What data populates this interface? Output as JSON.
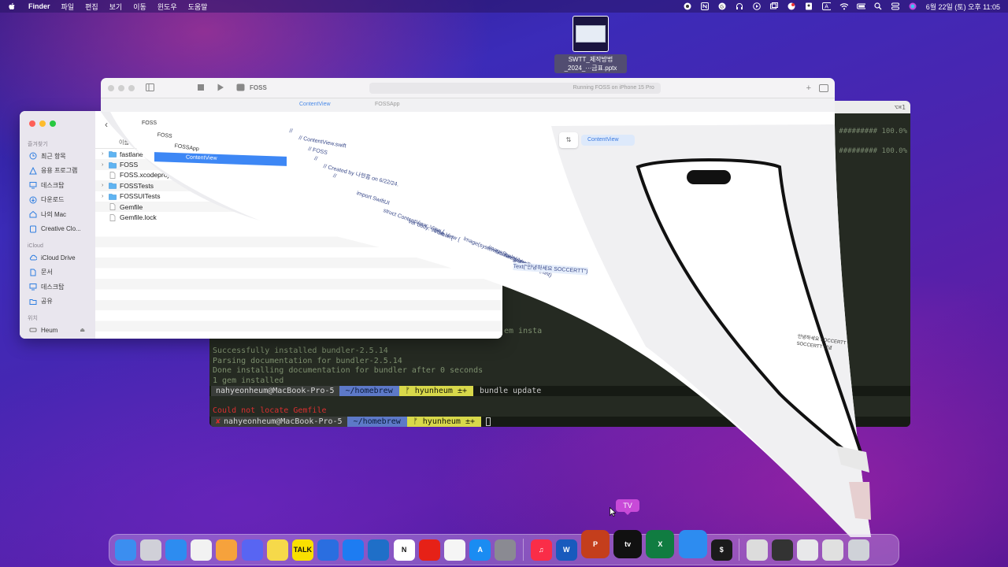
{
  "menubar": {
    "app": "Finder",
    "items": [
      "파일",
      "편집",
      "보기",
      "이동",
      "윈도우",
      "도움말"
    ],
    "clock": "6월 22일 (토) 오후 11:05",
    "status_icons": [
      "record-icon",
      "n-icon",
      "app-icon",
      "headphones-icon",
      "play-icon",
      "window-icon",
      "notify-icon",
      "person-icon",
      "a-icon",
      "wifi-icon",
      "battery-icon",
      "search-icon",
      "control-center-icon",
      "siri-icon"
    ]
  },
  "desktop_file": {
    "name_line1": "SWTT_제작방법",
    "name_line2": "_2024_···금표.pptx"
  },
  "terminal": {
    "progress_lines": [
      "######### 100.0%",
      "######### 100.0%"
    ],
    "partial_line": "em insta",
    "lines": [
      "Successfully installed bundler-2.5.14",
      "Parsing documentation for bundler-2.5.14",
      "Done installing documentation for bundler after 0 seconds",
      "1 gem installed"
    ],
    "prompt1": {
      "user": "nahyeonheum@MacBook-Pro-5",
      "dir": "~/homebrew",
      "branch": "ᚠ hyunheum ±+",
      "cmd": "bundle update"
    },
    "error": "Could not locate Gemfile",
    "prompt2": {
      "marker": "✘",
      "user": "nahyeonheum@MacBook-Pro-5",
      "dir": "~/homebrew",
      "branch": "ᚠ hyunheum ±+"
    },
    "title_right": "⌥⌘1"
  },
  "finder": {
    "sidebar": {
      "favorites_title": "즐겨찾기",
      "favorites": [
        {
          "label": "최근 항목",
          "icon": "clock-icon"
        },
        {
          "label": "응용 프로그램",
          "icon": "apps-icon"
        },
        {
          "label": "데스크탑",
          "icon": "desktop-icon"
        },
        {
          "label": "다운로드",
          "icon": "download-icon"
        },
        {
          "label": "나의 Mac",
          "icon": "house-icon"
        },
        {
          "label": "Creative Clo...",
          "icon": "cloud-doc-icon"
        }
      ],
      "icloud_title": "iCloud",
      "icloud": [
        {
          "label": "iCloud Drive",
          "icon": "cloud-icon"
        },
        {
          "label": "문서",
          "icon": "document-icon"
        },
        {
          "label": "데스크탑",
          "icon": "desktop-icon"
        },
        {
          "label": "공유",
          "icon": "shared-folder-icon"
        }
      ],
      "locations_title": "위치",
      "locations": [
        {
          "label": "Heum",
          "icon": "disk-icon"
        }
      ]
    },
    "column_header": "이름",
    "files": [
      {
        "name": "fastlane",
        "folder": true,
        "expandable": true
      },
      {
        "name": "FOSS",
        "folder": true,
        "expandable": true
      },
      {
        "name": "FOSS.xcodeproj",
        "folder": false,
        "expandable": false
      },
      {
        "name": "FOSSTests",
        "folder": true,
        "expandable": true
      },
      {
        "name": "FOSSUITests",
        "folder": true,
        "expandable": true
      },
      {
        "name": "Gemfile",
        "folder": false,
        "expandable": false
      },
      {
        "name": "Gemfile.lock",
        "folder": false,
        "expandable": false
      }
    ]
  },
  "xcode": {
    "app_name": "FOSS",
    "status": "Running FOSS on iPhone 15 Pro",
    "nav_root": "FOSS",
    "nav_group": "FOSS",
    "nav_sub": "FOSSApp",
    "nav_selected": "ContentView",
    "tabs": [
      "ContentView",
      "FOSSApp"
    ],
    "code_lines": [
      "//",
      "//  ContentView.swift",
      "//  FOSS",
      "//",
      "//  Created by 나현흠 on 6/22/24.",
      "//",
      "import SwiftUI",
      "struct ContentView: View {",
      "var body: some View {",
      "VStack {",
      "Image(systemName: \"globe\")",
      ".imageScale(.large)",
      ".foregroundStyle(.tint)",
      "Text(\"안녕하세요 SOCCERTT\")"
    ],
    "canvas_tab": "ContentView",
    "preview_text_1": "안녕하세요 SOCCERTT",
    "preview_text_2": "SOCCERTT 안녕"
  },
  "dock": {
    "tooltip": "TV",
    "apps": [
      {
        "name": "finder-icon",
        "color": "#3b8ef0",
        "label": ""
      },
      {
        "name": "launchpad-icon",
        "color": "#d0d0d8",
        "label": ""
      },
      {
        "name": "safari-icon",
        "color": "#2d8cf0",
        "label": ""
      },
      {
        "name": "chrome-icon",
        "color": "#f2f2f2",
        "label": ""
      },
      {
        "name": "photos-icon",
        "color": "#f6a23c",
        "label": ""
      },
      {
        "name": "discord-icon",
        "color": "#5865f2",
        "label": ""
      },
      {
        "name": "notes-icon",
        "color": "#f6d94a",
        "label": ""
      },
      {
        "name": "kakaotalk-icon",
        "color": "#f9e000",
        "label": "TALK"
      },
      {
        "name": "xcode-cloud-icon",
        "color": "#2a6ee0",
        "label": ""
      },
      {
        "name": "xcode-icon",
        "color": "#1d7cf2",
        "label": ""
      },
      {
        "name": "vscode-icon",
        "color": "#1f6fc8",
        "label": ""
      },
      {
        "name": "notion-icon",
        "color": "#ffffff",
        "label": "N"
      },
      {
        "name": "youtube-icon",
        "color": "#e62117",
        "label": ""
      },
      {
        "name": "freeform-icon",
        "color": "#f5f5f5",
        "label": ""
      },
      {
        "name": "app-store-icon",
        "color": "#1a8cf2",
        "label": "A"
      },
      {
        "name": "system-settings-icon",
        "color": "#8a8a92",
        "label": ""
      },
      {
        "name": "music-icon",
        "color": "#fa2d48",
        "label": "♫"
      },
      {
        "name": "word-icon",
        "color": "#185abd",
        "label": "W"
      },
      {
        "name": "powerpoint-icon",
        "color": "#c43e1c",
        "label": "P"
      },
      {
        "name": "apple-tv-icon",
        "color": "#111111",
        "label": "tv"
      },
      {
        "name": "excel-icon",
        "color": "#107c41",
        "label": "X"
      },
      {
        "name": "simulator-icon",
        "color": "#2d8cf0",
        "label": ""
      },
      {
        "name": "terminal-icon",
        "color": "#1b1b1b",
        "label": "$"
      },
      {
        "name": "preview-icon",
        "color": "#dcdcdc",
        "label": ""
      },
      {
        "name": "iphone-mirror-icon",
        "color": "#333333",
        "label": ""
      },
      {
        "name": "mail-icon",
        "color": "#e8e8ea",
        "label": ""
      },
      {
        "name": "screen-icon",
        "color": "#e0e0e0",
        "label": ""
      },
      {
        "name": "trash-icon",
        "color": "#cfd2d8",
        "label": ""
      }
    ]
  }
}
